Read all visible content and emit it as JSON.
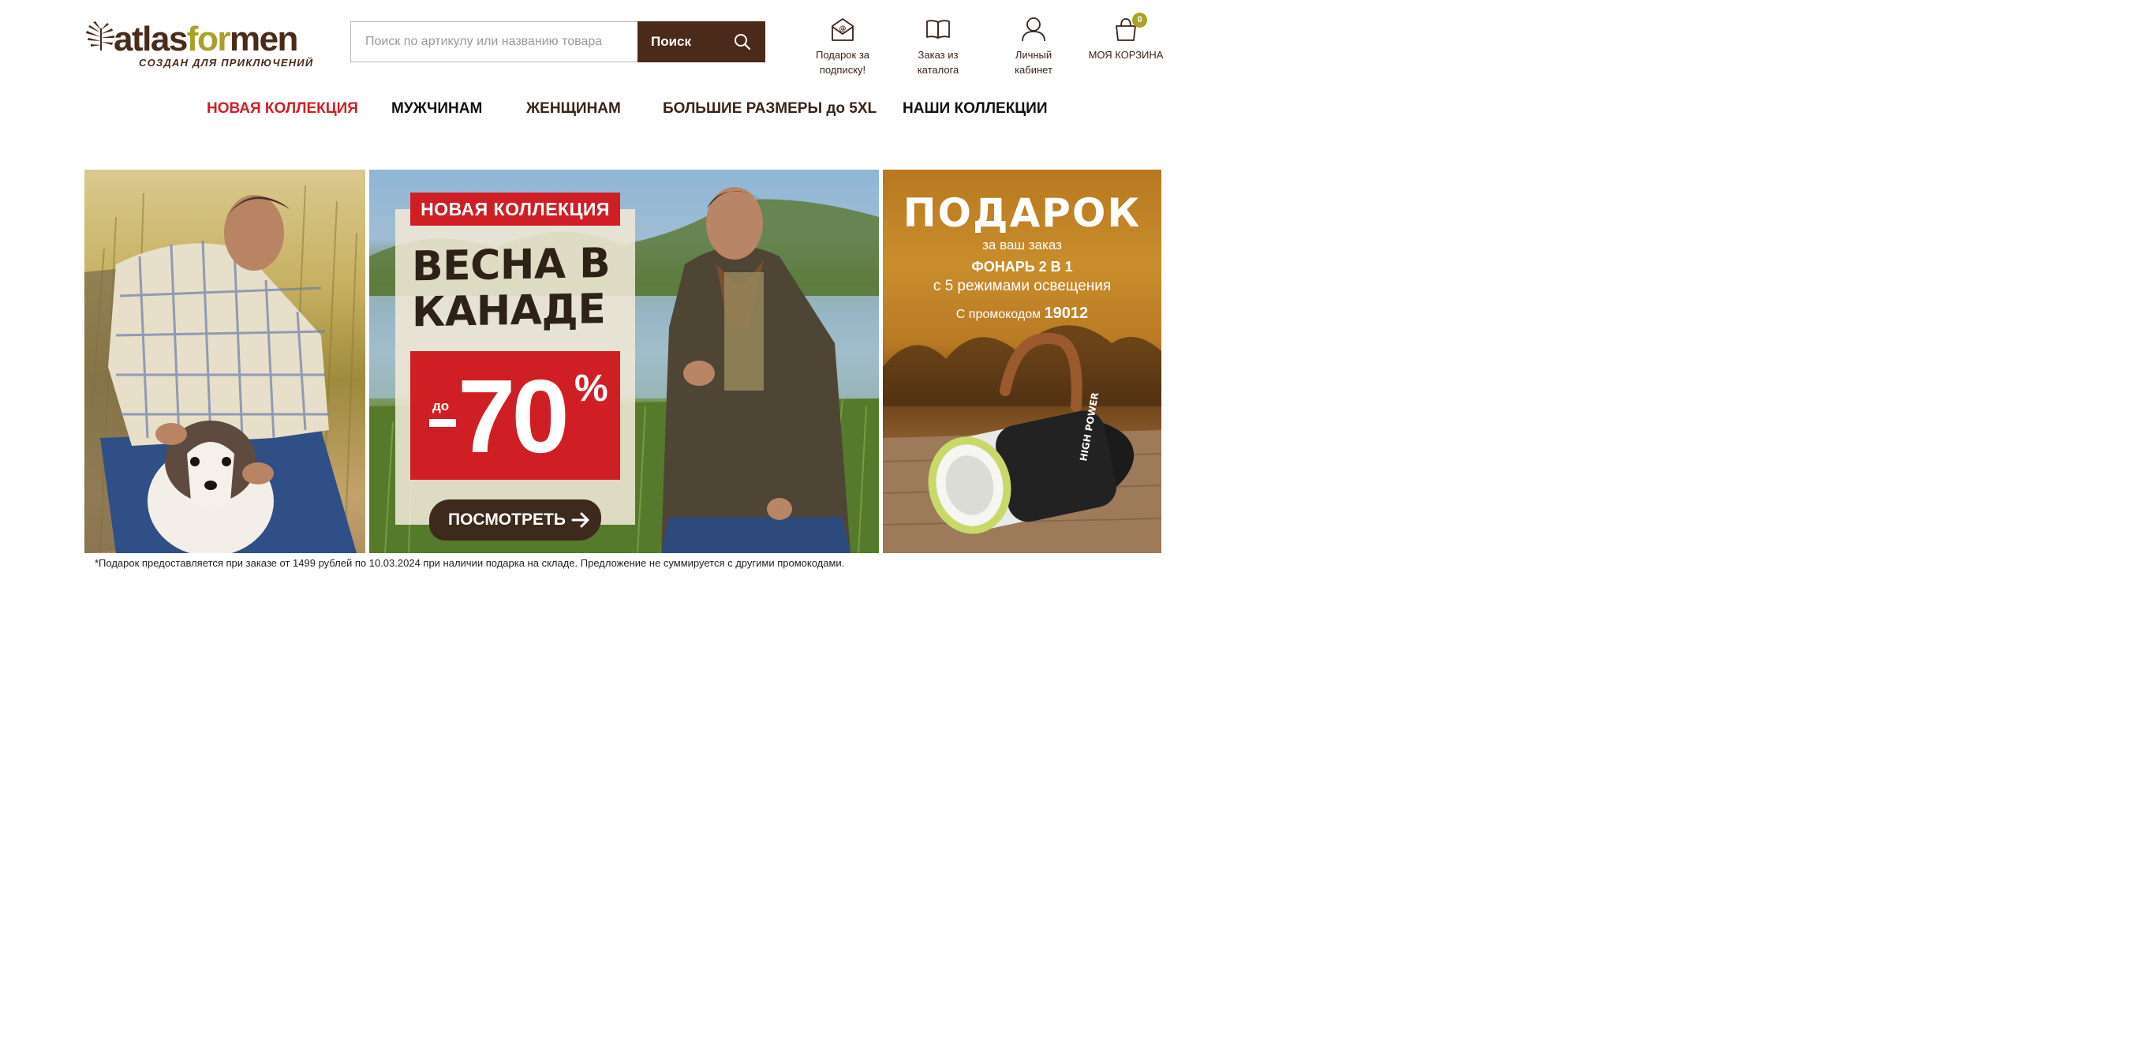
{
  "header": {
    "logo": {
      "word_main": "atlas",
      "word_for": "for",
      "word_men": "men",
      "tagline": "СОЗДАН ДЛЯ ПРИКЛЮЧЕНИЙ"
    },
    "search": {
      "placeholder": "Поиск по артикулу или названию товара",
      "button_label": "Поиск"
    },
    "links": [
      {
        "label_line1": "Подарок за",
        "label_line2": "подписку!",
        "icon": "envelope-icon"
      },
      {
        "label_line1": "Заказ из",
        "label_line2": "каталога",
        "icon": "catalog-book-icon"
      },
      {
        "label_line1": "Личный",
        "label_line2": "кабинет",
        "icon": "user-icon"
      }
    ],
    "cart": {
      "label": "МОЯ КОРЗИНА",
      "count": "0",
      "icon": "cart-bag-icon"
    }
  },
  "nav": [
    {
      "label": "НОВАЯ КОЛЛЕКЦИЯ",
      "color": "#cf1f24"
    },
    {
      "label": "МУЖЧИНАМ"
    },
    {
      "label": "ЖЕНЩИНАМ"
    },
    {
      "label": "БОЛЬШИЕ РАЗМЕРЫ до 5XL"
    },
    {
      "label": "НАШИ КОЛЛЕКЦИИ"
    }
  ],
  "banners": {
    "promo": {
      "tag": "НОВАЯ КОЛЛЕКЦИЯ",
      "title_line1": "ВЕСНА В",
      "title_line2": "КАНАДЕ",
      "discount_prefix": "до",
      "discount_value": "70",
      "discount_unit": "%",
      "cta": "ПОСМОТРЕТЬ"
    },
    "gift": {
      "title": "ПОДАРОК",
      "line1": "за ваш заказ",
      "line2": "ФОНАРЬ 2 В 1",
      "line3": "с 5 режимами освещения",
      "promo_prefix": "С промокодом",
      "promo_code": "19012",
      "product_brand": "HIGH POWER"
    }
  },
  "disclaimer": "*Подарок предоставляется при заказе от 1499 рублей по 10.03.2024 при наличии подарка на складе. Предложение не суммируется с другими промокодами.",
  "colors": {
    "brand_brown": "#4a2a18",
    "brand_olive": "#a9a128",
    "accent_red": "#cf1f24"
  }
}
